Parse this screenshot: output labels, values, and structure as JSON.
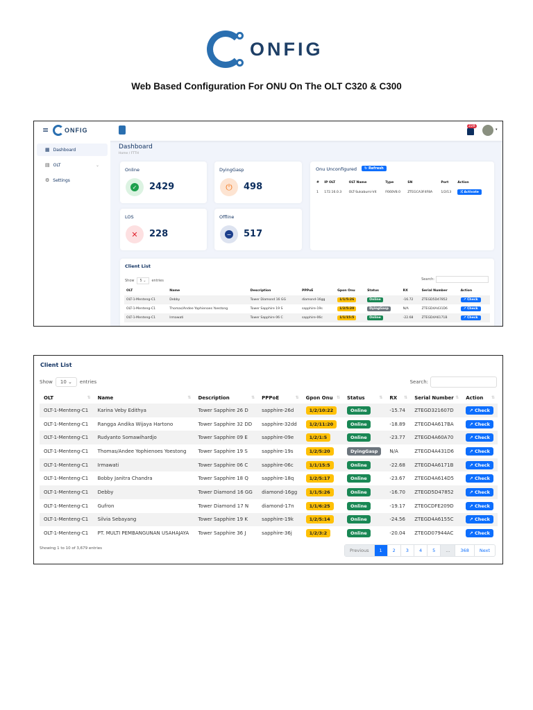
{
  "logo": {
    "text": "ONFIG"
  },
  "document_title": "Web Based Configuration For ONU On The OLT C320 & C300",
  "app": {
    "brand": "ONFIG",
    "notification_count": "228",
    "sidebar": [
      {
        "label": "Dashboard",
        "icon": "grid-icon"
      },
      {
        "label": "OLT",
        "icon": "table-icon"
      },
      {
        "label": "Settings",
        "icon": "gear-icon"
      }
    ],
    "page_title": "Dashboard",
    "breadcrumb": "Home / FTTH",
    "stats": [
      {
        "label": "Online",
        "value": "2429",
        "color": "#1ea04d"
      },
      {
        "label": "DyingGasp",
        "value": "498",
        "color": "#f27a21"
      },
      {
        "label": "LOS",
        "value": "228",
        "color": "#e0242f"
      },
      {
        "label": "Offline",
        "value": "517",
        "color": "#1c3f8c"
      }
    ],
    "onu_unconfigured": {
      "title": "Onu Unconfigured",
      "refresh_label": "Refresh",
      "headers": [
        "#",
        "IP OLT",
        "OLT Name",
        "Type",
        "SN",
        "Port",
        "Action"
      ],
      "rows": [
        [
          "1",
          "172.16.0.3",
          "OLT-Sukabumi-V4",
          "F660V8.0",
          "ZTEGCA3F4F8A",
          "1/2/13",
          "Activate"
        ]
      ]
    },
    "client_list_small": {
      "title": "Client List",
      "show_label": "Show",
      "entries_value": "5",
      "entries_label": "entries",
      "search_label": "Search:",
      "headers": [
        "OLT",
        "Name",
        "Description",
        "PPPoE",
        "Gpon Onu",
        "Status",
        "RX",
        "Serial Number",
        "Action"
      ],
      "rows": [
        [
          "OLT-1-Menteng-C1",
          "Debby",
          "Tower Diamond 16 GG",
          "diamond-16gg",
          "1/1/5:26",
          "Online",
          "-16.72",
          "ZTEGD5D47852",
          "Check"
        ],
        [
          "OLT-1-Menteng-C1",
          "Thomas/Andee Yophienoes Yoestong",
          "Tower Sapphire 19 S",
          "sapphire-19s",
          "1/2/5:20",
          "DyingGasp",
          "N/A",
          "ZTEGD4A431D6",
          "Check"
        ],
        [
          "OLT-1-Menteng-C1",
          "Irmawati",
          "Tower Sapphire 06 C",
          "sapphire-06c",
          "1/1/15:5",
          "Online",
          "-22.68",
          "ZTEGD4A6171B",
          "Check"
        ]
      ]
    }
  },
  "client_list": {
    "title": "Client List",
    "show_label": "Show",
    "entries_value": "10",
    "entries_label": "entries",
    "search_label": "Search:",
    "headers": [
      "OLT",
      "Name",
      "Description",
      "PPPoE",
      "Gpon Onu",
      "Status",
      "RX",
      "Serial Number",
      "Action"
    ],
    "rows": [
      [
        "OLT-1-Menteng-C1",
        "Karina Veby Edithya",
        "Tower Sapphire 26 D",
        "sapphire-26d",
        "1/2/10:22",
        "Online",
        "-15.74",
        "ZTEGD321607D",
        "Check"
      ],
      [
        "OLT-1-Menteng-C1",
        "Rangga Andika Wijaya Hartono",
        "Tower Sapphire 32 DD",
        "sapphire-32dd",
        "1/2/11:20",
        "Online",
        "-18.89",
        "ZTEGD4A617BA",
        "Check"
      ],
      [
        "OLT-1-Menteng-C1",
        "Rudyanto Somawihardjo",
        "Tower Sapphire 09 E",
        "sapphire-09e",
        "1/2/1:5",
        "Online",
        "-23.77",
        "ZTEGD4A60A70",
        "Check"
      ],
      [
        "OLT-1-Menteng-C1",
        "Thomas/Andee Yophienoes Yoestong",
        "Tower Sapphire 19 S",
        "sapphire-19s",
        "1/2/5:20",
        "DyingGasp",
        "N/A",
        "ZTEGD4A431D6",
        "Check"
      ],
      [
        "OLT-1-Menteng-C1",
        "Irmawati",
        "Tower Sapphire 06 C",
        "sapphire-06c",
        "1/1/15:5",
        "Online",
        "-22.68",
        "ZTEGD4A6171B",
        "Check"
      ],
      [
        "OLT-1-Menteng-C1",
        "Bobby Janitra Chandra",
        "Tower Sapphire 18 Q",
        "sapphire-18q",
        "1/2/5:17",
        "Online",
        "-23.67",
        "ZTEGD4A614D5",
        "Check"
      ],
      [
        "OLT-1-Menteng-C1",
        "Debby",
        "Tower Diamond 16 GG",
        "diamond-16gg",
        "1/1/5:26",
        "Online",
        "-16.70",
        "ZTEGD5D47852",
        "Check"
      ],
      [
        "OLT-1-Menteng-C1",
        "Gufron",
        "Tower Diamond 17 N",
        "diamond-17n",
        "1/1/6:25",
        "Online",
        "-19.17",
        "ZTEGCDFE209D",
        "Check"
      ],
      [
        "OLT-1-Menteng-C1",
        "Silvia Sebayang",
        "Tower Sapphire 19 K",
        "sapphire-19k",
        "1/2/5:14",
        "Online",
        "-24.56",
        "ZTEGD4A6155C",
        "Check"
      ],
      [
        "OLT-1-Menteng-C1",
        "PT. MULTI PEMBANGUNAN USAHAJAYA",
        "Tower Sapphire 36 J",
        "sapphire-36j",
        "1/2/3:2",
        "Online",
        "-20.04",
        "ZTEGD07944AC",
        "Check"
      ]
    ],
    "footer": "Showing 1 to 10 of 3,679 entries",
    "pagination": [
      "Previous",
      "1",
      "2",
      "3",
      "4",
      "5",
      "...",
      "368",
      "Next"
    ],
    "current_page": "1"
  }
}
